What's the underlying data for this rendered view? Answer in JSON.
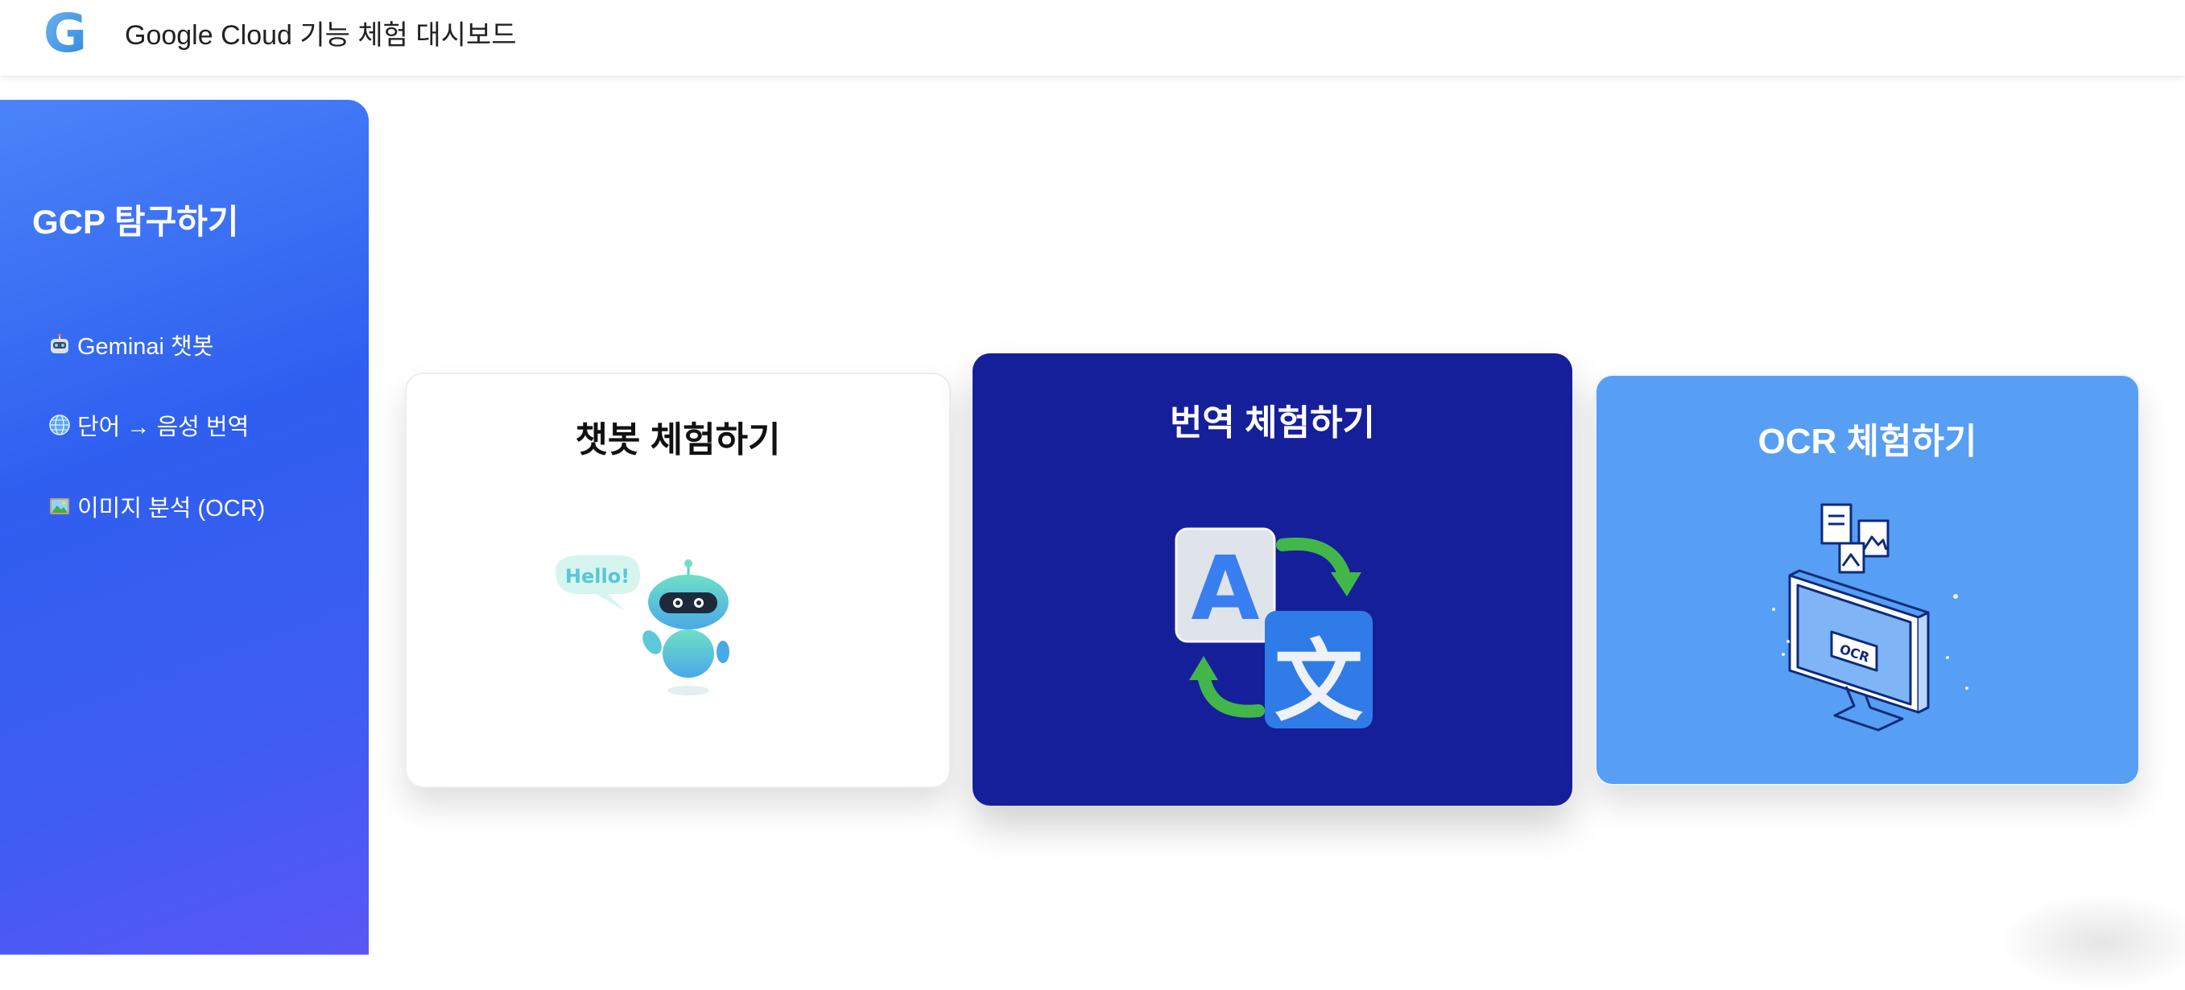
{
  "header": {
    "logo_letter": "G",
    "title": "Google Cloud 기능 체험 대시보드"
  },
  "sidebar": {
    "title": "GCP 탐구하기",
    "items": [
      {
        "icon": "robot-icon",
        "label": "Geminai 챗봇"
      },
      {
        "icon": "globe-icon",
        "label": "단어 → 음성 번역"
      },
      {
        "icon": "picture-icon",
        "label": "이미지 분석 (OCR)"
      }
    ]
  },
  "cards": [
    {
      "title": "챗봇 체험하기",
      "illustration": "robot-hello-icon",
      "bubble_text": "Hello!"
    },
    {
      "title": "번역 체험하기",
      "illustration": "translate-icon",
      "glyph_a": "A",
      "glyph_b": "文"
    },
    {
      "title": "OCR 체험하기",
      "illustration": "ocr-monitor-icon",
      "screen_label": "OCR"
    }
  ],
  "colors": {
    "sidebar_start": "#4a84f8",
    "sidebar_end": "#5a57f4",
    "chatbot_card": "#ffffff",
    "translate_card": "#151f9a",
    "ocr_card": "#579ef5"
  }
}
